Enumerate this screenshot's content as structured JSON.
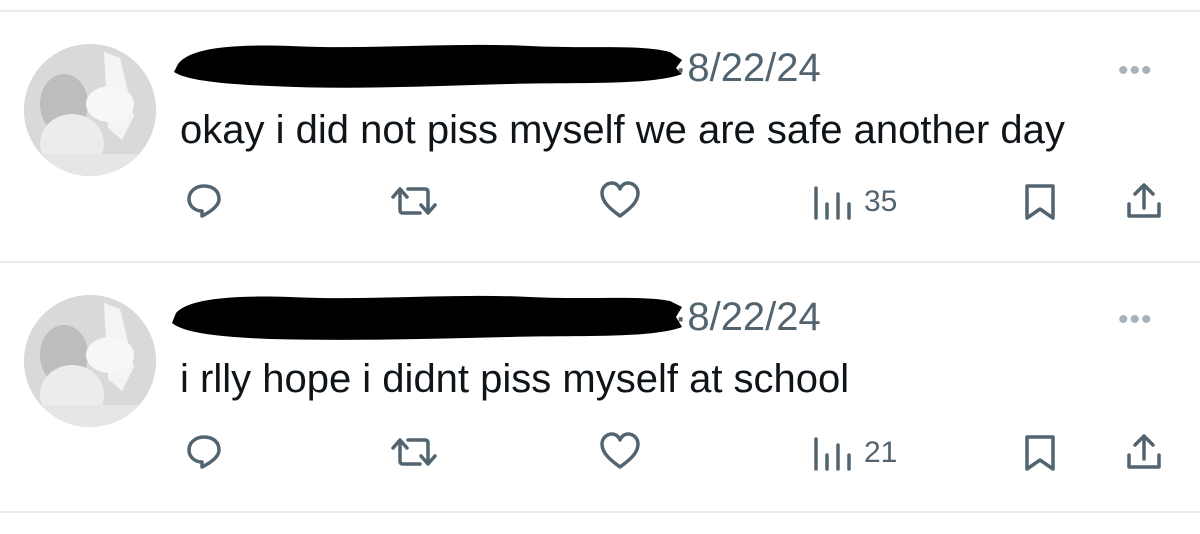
{
  "posts": [
    {
      "date_separator": "·",
      "date": "8/22/24",
      "text": "okay i did not piss myself we are safe another day",
      "more_label": "•••",
      "views_count": "35"
    },
    {
      "date_separator": "·",
      "date": "8/22/24",
      "text": "i rlly hope i didnt piss myself at school",
      "more_label": "•••",
      "views_count": "21"
    }
  ],
  "colors": {
    "text": "#0f1419",
    "muted": "#536471",
    "divider": "#e9ecef",
    "redaction": "#000000"
  },
  "icons": {
    "reply": "comment-bubble-icon",
    "repost": "repost-arrows-icon",
    "like": "heart-icon",
    "views": "bar-chart-icon",
    "bookmark": "bookmark-icon",
    "share": "share-upload-icon"
  }
}
